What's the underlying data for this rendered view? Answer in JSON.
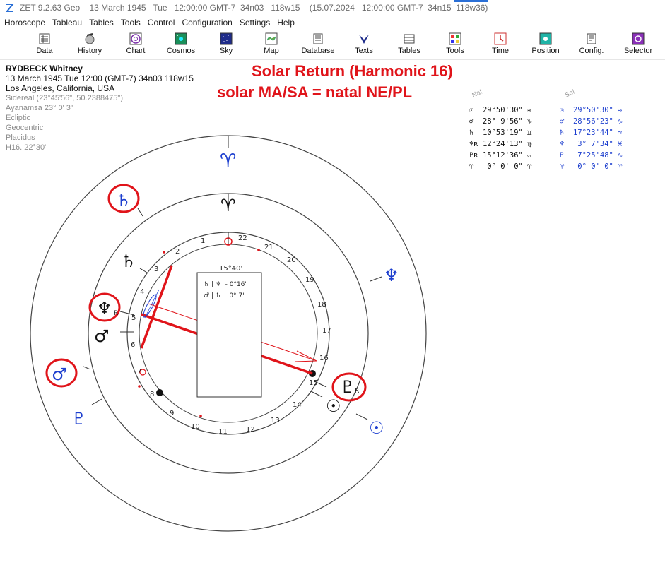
{
  "window": {
    "title": "ZET 9.2.63 Geo    13 March 1945   Tue   12:00:00 GMT-7  34n03   118w15    (15.07.2024   12:00:00 GMT-7  34n15  118w36)"
  },
  "menu": [
    "Horoscope",
    "Tableau",
    "Tables",
    "Tools",
    "Control",
    "Configuration",
    "Settings",
    "Help"
  ],
  "toolbar": [
    {
      "label": "Data",
      "icon": "data-icon"
    },
    {
      "label": "History",
      "icon": "history-icon"
    },
    {
      "label": "Chart",
      "icon": "chart-icon"
    },
    {
      "label": "Cosmos",
      "icon": "cosmos-icon"
    },
    {
      "label": "Sky",
      "icon": "sky-icon"
    },
    {
      "label": "Map",
      "icon": "map-icon"
    },
    {
      "label": "Database",
      "icon": "database-icon"
    },
    {
      "label": "Texts",
      "icon": "texts-icon"
    },
    {
      "label": "Tables",
      "icon": "tables-icon"
    },
    {
      "label": "Tools",
      "icon": "tools-icon"
    },
    {
      "label": "Time",
      "icon": "time-icon"
    },
    {
      "label": "Position",
      "icon": "position-icon"
    },
    {
      "label": "Config.",
      "icon": "config-icon"
    },
    {
      "label": "Selector",
      "icon": "selector-icon"
    }
  ],
  "chart_info": {
    "name": "RYDBECK Whitney",
    "datetime": "13 March 1945  Tue  12:00 (GMT-7) 34n03  118w15",
    "place": "Los Angeles, California, USA",
    "details": [
      "Sidereal (23°45'56\", 50.2388475\")",
      "Ayanamsa 23° 0' 3\"",
      "Ecliptic",
      "Geocentric",
      "Placidus",
      "H16.  22°30'"
    ]
  },
  "headline": {
    "line1": "Solar Return (Harmonic 16)",
    "line2": "solar MA/SA = natal NE/PL"
  },
  "positions": {
    "natal_header": "Nat",
    "solar_header": "Sol",
    "natal": [
      {
        "sym": "☉",
        "text": "  29°50'30\" ≈"
      },
      {
        "sym": "♂",
        "text": "  28° 9'56\" ♑"
      },
      {
        "sym": "♄",
        "text": "  10°53'19\" ♊"
      },
      {
        "sym": "♆",
        "text": "ʀ 12°24'13\" ♍"
      },
      {
        "sym": "♇",
        "text": "ʀ 15°12'36\" ♌"
      },
      {
        "sym": "♈",
        "text": "   0° 0' 0\" ♈"
      }
    ],
    "solar": [
      {
        "sym": "☉",
        "text": "  29°50'30\" ≈"
      },
      {
        "sym": "♂",
        "text": "  28°56'23\" ♑"
      },
      {
        "sym": "♄",
        "text": "  17°23'44\" ≈"
      },
      {
        "sym": "♆",
        "text": "   3° 7'34\" ♓"
      },
      {
        "sym": "♇",
        "text": "   7°25'48\" ♑"
      },
      {
        "sym": "♈",
        "text": "   0° 0' 0\" ♈"
      }
    ]
  },
  "wheel": {
    "house_numbers": [
      "1",
      "2",
      "3",
      "4",
      "5",
      "6",
      "7",
      "8",
      "9",
      "10",
      "11",
      "12",
      "13",
      "14",
      "15",
      "16",
      "17",
      "18",
      "19",
      "20",
      "21",
      "22"
    ],
    "aspect_box": {
      "title": "15°40'",
      "lines": [
        "♄ | ♆  - 0°16'",
        "♂ | ♄    0° 7'"
      ]
    },
    "glyphs": {
      "aries_outer": "♈",
      "aries_inner": "♈",
      "saturn_outer": "♄",
      "saturn_inner": "♄",
      "neptune_outer": "♆",
      "neptune_inner": "♆",
      "mars_outer": "♂",
      "mars_inner": "♂",
      "pluto_outer": "♇",
      "pluto_inner": "♇",
      "sun_outer": "☉",
      "sun_inner": "☉",
      "retro": "R"
    },
    "colors": {
      "natal": "#111111",
      "solar": "#1d3fcf",
      "highlight": "#e0141a"
    }
  }
}
